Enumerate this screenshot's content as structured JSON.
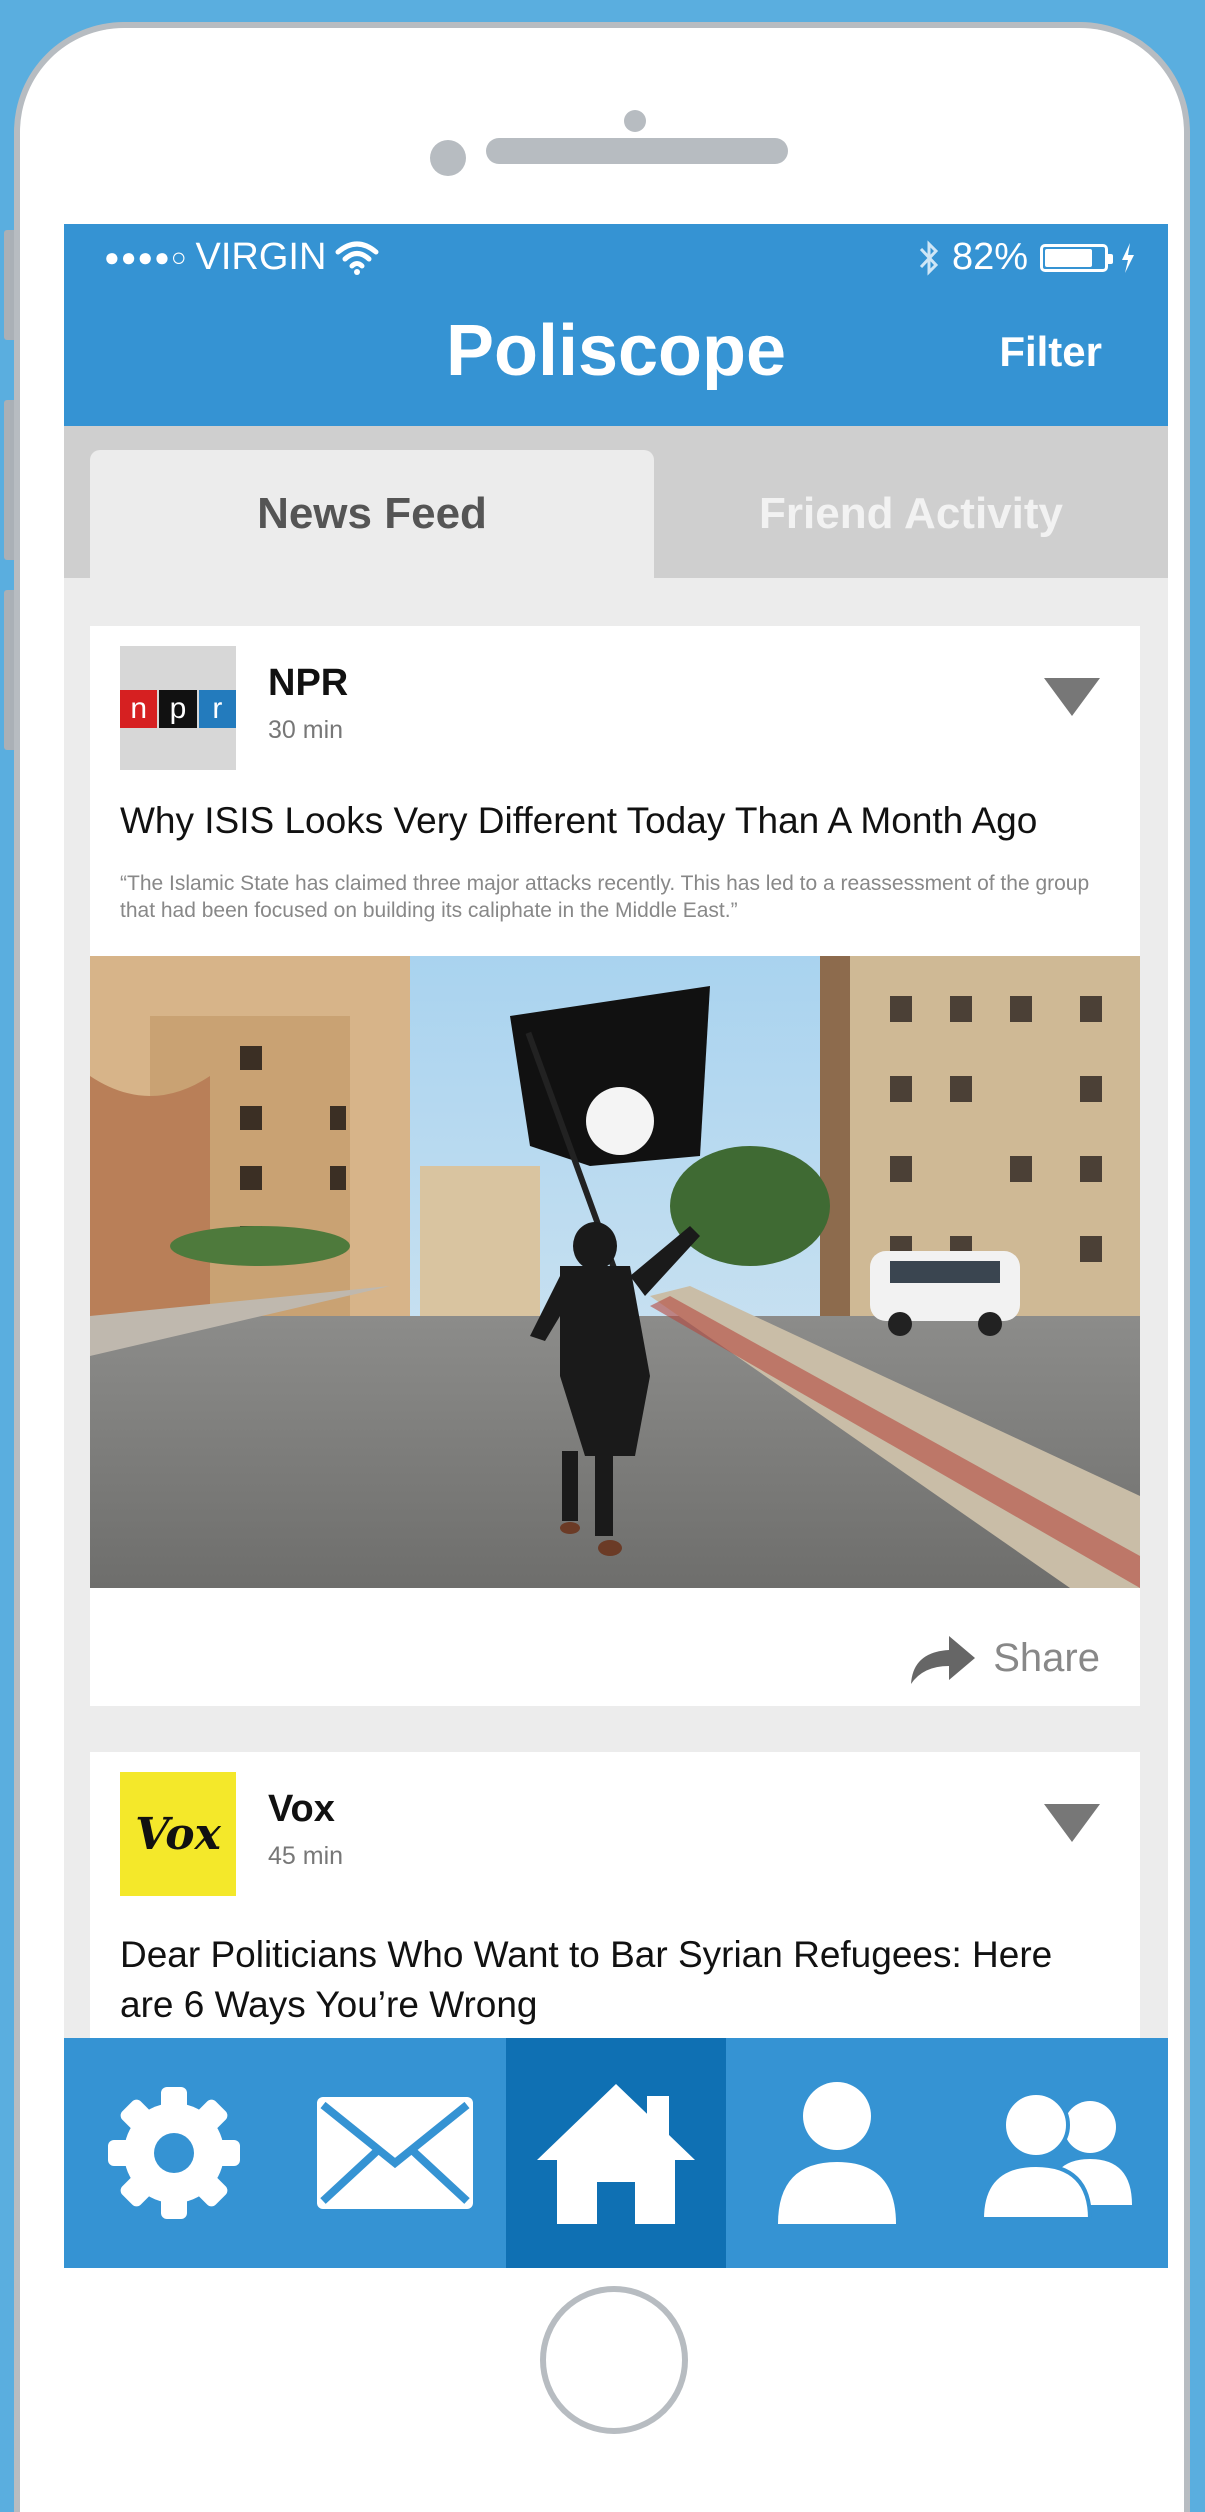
{
  "status": {
    "carrier": "VIRGIN",
    "battery_percent": "82%",
    "battery_level": 0.82
  },
  "header": {
    "title": "Poliscope",
    "filter_label": "Filter"
  },
  "tabs": [
    {
      "label": "News Feed",
      "active": true
    },
    {
      "label": "Friend Activity",
      "active": false
    }
  ],
  "feed": [
    {
      "logo_text": [
        "n",
        "p",
        "r"
      ],
      "source": "NPR",
      "time": "30 min",
      "headline": "Why ISIS Looks Very Different Today Than A Month Ago",
      "summary": "“The Islamic State has claimed three major attacks recently. This has led to a reassessment of the group that had been focused on building its caliphate in the Middle East.”",
      "share_label": "Share"
    },
    {
      "logo_text": "Vox",
      "source": "Vox",
      "time": "45 min",
      "headline": "Dear Politicians Who Want to Bar Syrian Refugees: Here are 6 Ways You’re Wrong"
    }
  ],
  "tabbar": [
    {
      "icon": "gear-icon",
      "active": false
    },
    {
      "icon": "mail-icon",
      "active": false
    },
    {
      "icon": "home-icon",
      "active": true
    },
    {
      "icon": "user-icon",
      "active": false
    },
    {
      "icon": "group-icon",
      "active": false
    }
  ],
  "colors": {
    "background": "#5aaedf",
    "brand": "#3593d3",
    "tab_active": "#0f70b3",
    "npr_red": "#d62021",
    "npr_blue": "#237bbd",
    "vox_yellow": "#f4e82a"
  }
}
